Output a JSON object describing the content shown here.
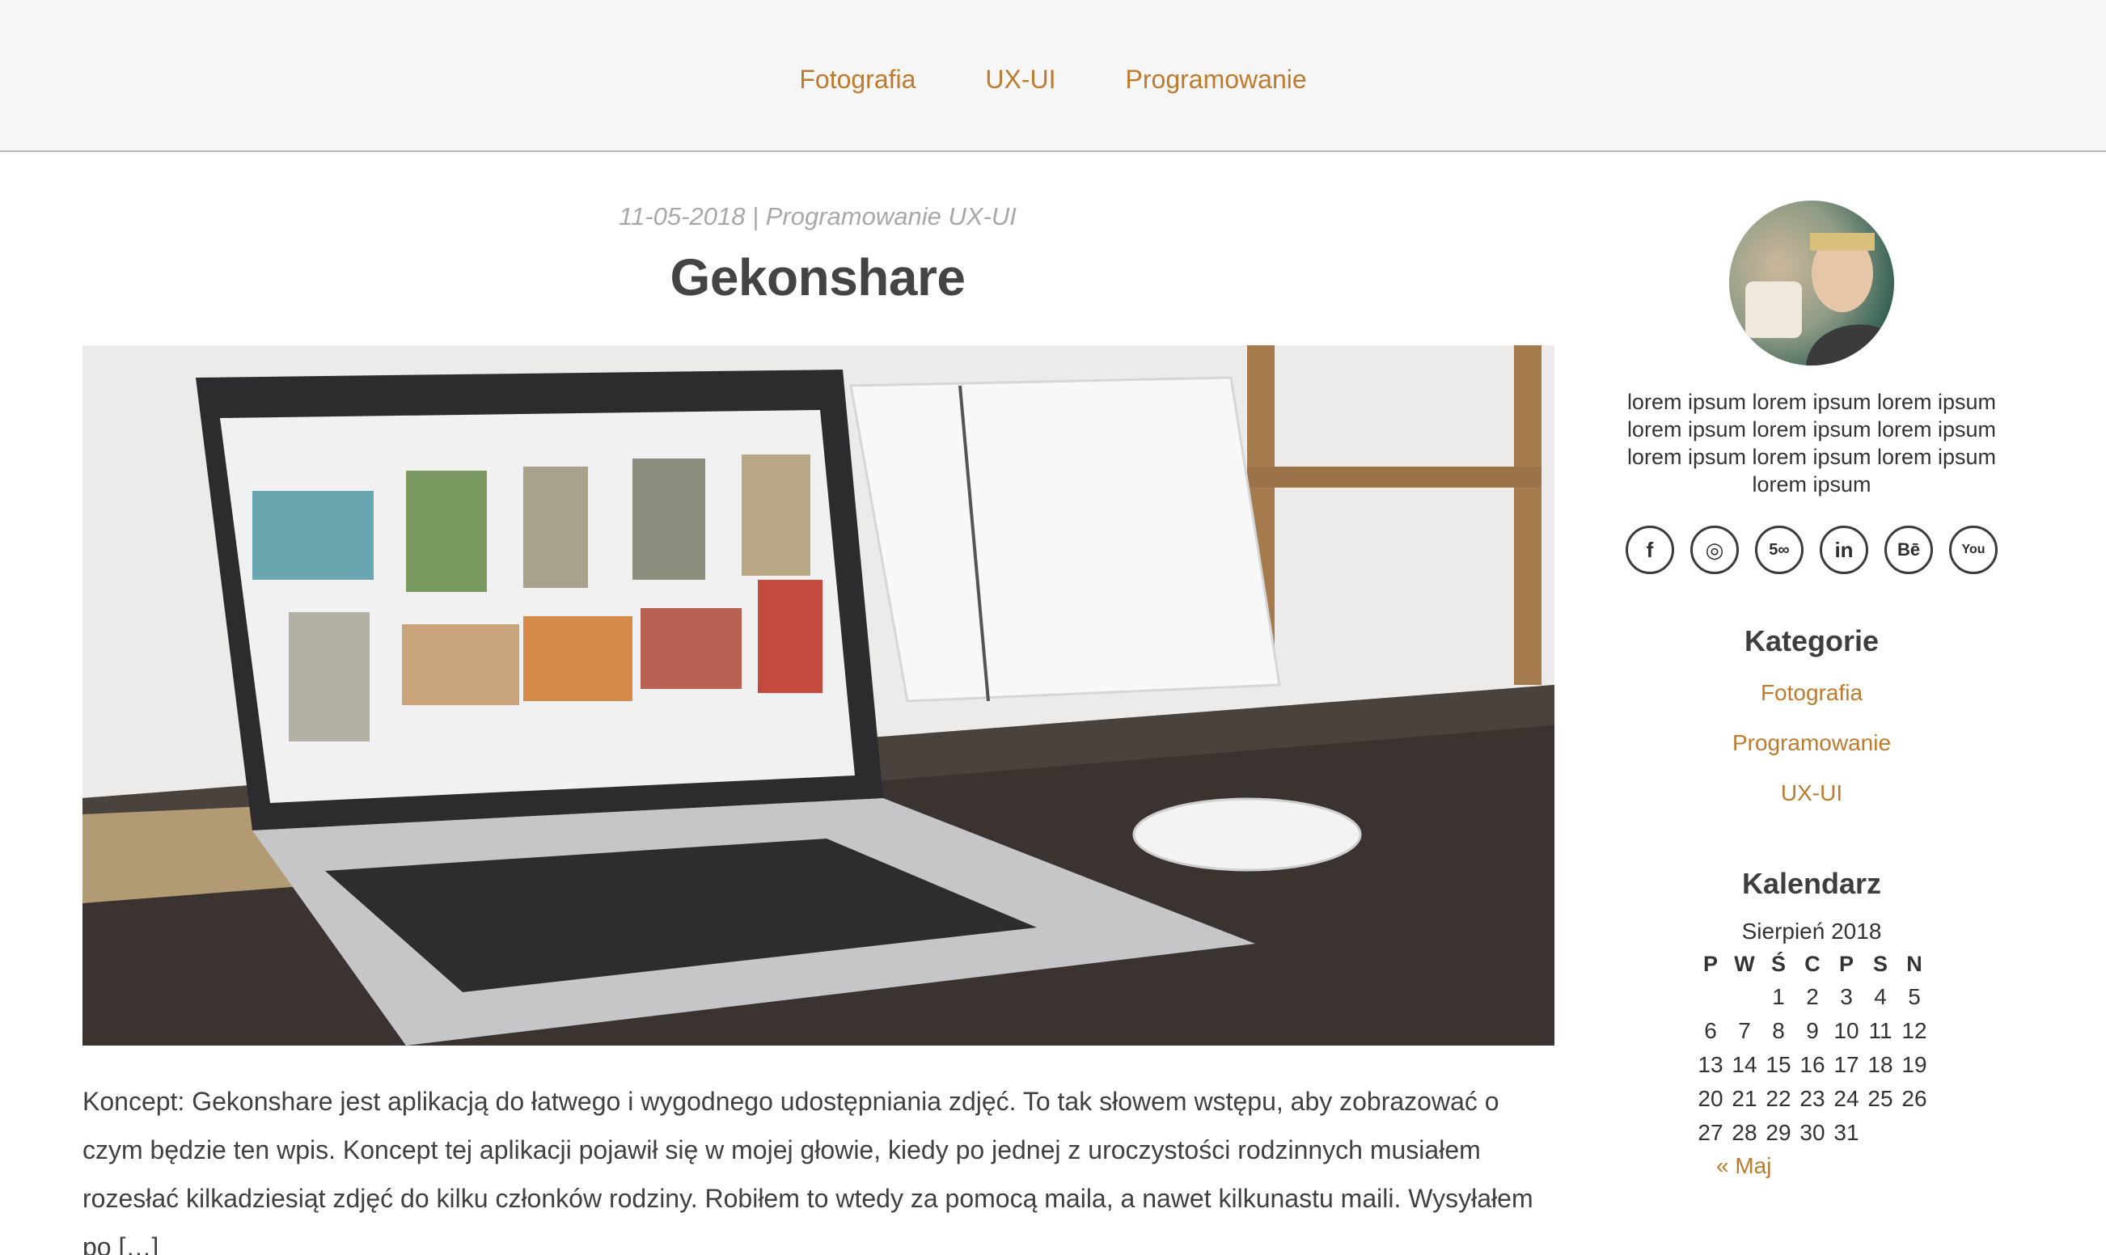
{
  "nav": {
    "items": [
      "Fotografia",
      "UX-UI",
      "Programowanie"
    ]
  },
  "post": {
    "meta": "11-05-2018 | Programowanie UX-UI",
    "title": "Gekonshare",
    "excerpt": "Koncept: Gekonshare jest aplikacją do łatwego i wygodnego udostępniania zdjęć. To tak słowem wstępu, aby zobrazować o czym będzie ten wpis. Koncept tej aplikacji pojawił się w mojej głowie, kiedy po jednej z uroczystości rodzinnych musiałem rozesłać kilkadziesiąt zdjęć do kilku członków rodziny. Robiłem to wtedy za pomocą maila, a nawet kilkunastu maili. Wysyłałem po […]"
  },
  "sidebar": {
    "bio": "lorem ipsum lorem ipsum lorem ipsum lorem ipsum lorem ipsum lorem ipsum lorem ipsum lorem ipsum lorem ipsum lorem ipsum",
    "social": [
      {
        "icon": "facebook-icon",
        "glyph": "f"
      },
      {
        "icon": "instagram-icon",
        "glyph": "◎"
      },
      {
        "icon": "500px-icon",
        "glyph": "5∞"
      },
      {
        "icon": "linkedin-icon",
        "glyph": "in"
      },
      {
        "icon": "behance-icon",
        "glyph": "Bē"
      },
      {
        "icon": "youtube-icon",
        "glyph": "You"
      }
    ],
    "categories_title": "Kategorie",
    "categories": [
      "Fotografia",
      "Programowanie",
      "UX-UI"
    ],
    "calendar_title": "Kalendarz",
    "calendar": {
      "caption": "Sierpień 2018",
      "weekdays": [
        "P",
        "W",
        "Ś",
        "C",
        "P",
        "S",
        "N"
      ],
      "weeks": [
        [
          "",
          "",
          "1",
          "2",
          "3",
          "4",
          "5"
        ],
        [
          "6",
          "7",
          "8",
          "9",
          "10",
          "11",
          "12"
        ],
        [
          "13",
          "14",
          "15",
          "16",
          "17",
          "18",
          "19"
        ],
        [
          "20",
          "21",
          "22",
          "23",
          "24",
          "25",
          "26"
        ],
        [
          "27",
          "28",
          "29",
          "30",
          "31",
          "",
          ""
        ]
      ],
      "prev": "« Maj"
    }
  },
  "colors": {
    "accent": "#c07a2c",
    "header_bg": "#f6f6f6",
    "text": "#3e3e3e",
    "meta": "#a8a8a8"
  }
}
